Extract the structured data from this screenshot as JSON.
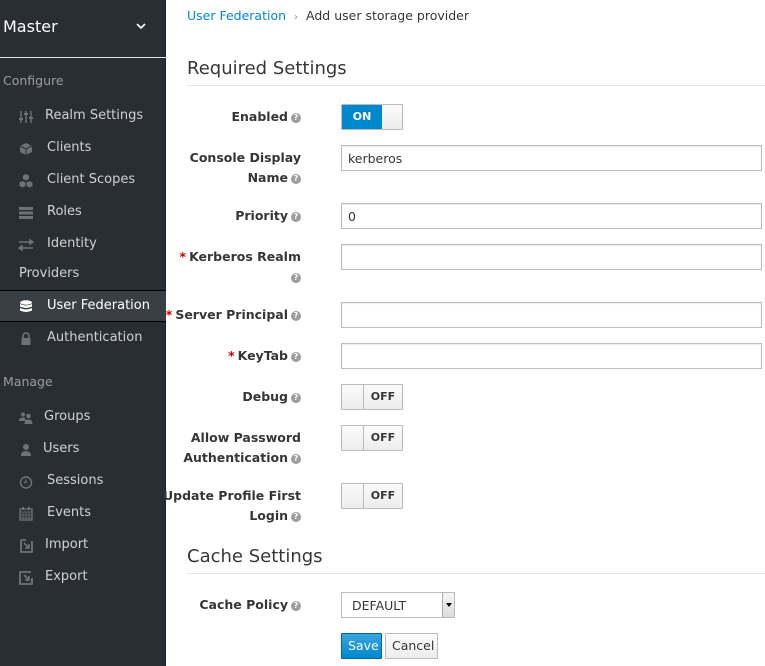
{
  "sidebar": {
    "realm": "Master",
    "sections": {
      "configure": "Configure",
      "manage": "Manage"
    },
    "configure_items": [
      {
        "label": "Realm Settings",
        "icon": "sliders-icon"
      },
      {
        "label": "Clients",
        "icon": "cube-icon"
      },
      {
        "label": "Client Scopes",
        "icon": "cubes-icon"
      },
      {
        "label": "Roles",
        "icon": "list-icon"
      },
      {
        "label": "Identity",
        "label2": "Providers",
        "icon": "exchange-icon"
      },
      {
        "label": "User Federation",
        "icon": "database-icon",
        "active": true
      },
      {
        "label": "Authentication",
        "icon": "lock-icon"
      }
    ],
    "manage_items": [
      {
        "label": "Groups",
        "icon": "users-icon"
      },
      {
        "label": "Users",
        "icon": "user-icon"
      },
      {
        "label": "Sessions",
        "icon": "clock-icon"
      },
      {
        "label": "Events",
        "icon": "calendar-icon"
      },
      {
        "label": "Import",
        "icon": "import-icon"
      },
      {
        "label": "Export",
        "icon": "export-icon"
      }
    ]
  },
  "breadcrumb": {
    "parent": "User Federation",
    "separator": "›",
    "current": "Add user storage provider"
  },
  "required_settings": {
    "title": "Required Settings",
    "help_glyph": "?",
    "required_marker": "*",
    "enabled": {
      "label": "Enabled",
      "value": "ON",
      "on": true
    },
    "console_display_name": {
      "label1": "Console Display",
      "label2": "Name",
      "value": "kerberos"
    },
    "priority": {
      "label": "Priority",
      "value": "0"
    },
    "kerberos_realm": {
      "label": "Kerberos Realm",
      "value": "",
      "required": true
    },
    "server_principal": {
      "label": "Server Principal",
      "value": "",
      "required": true
    },
    "keytab": {
      "label": "KeyTab",
      "value": "",
      "required": true
    },
    "debug": {
      "label": "Debug",
      "value": "OFF",
      "on": false
    },
    "allow_password_auth": {
      "label1": "Allow Password",
      "label2": "Authentication",
      "value": "OFF",
      "on": false
    },
    "update_profile_first_login": {
      "label1": "Update Profile First",
      "label2": "Login",
      "value": "OFF",
      "on": false
    }
  },
  "cache_settings": {
    "title": "Cache Settings",
    "cache_policy": {
      "label": "Cache Policy",
      "value": "DEFAULT"
    }
  },
  "actions": {
    "save": "Save",
    "cancel": "Cancel"
  }
}
